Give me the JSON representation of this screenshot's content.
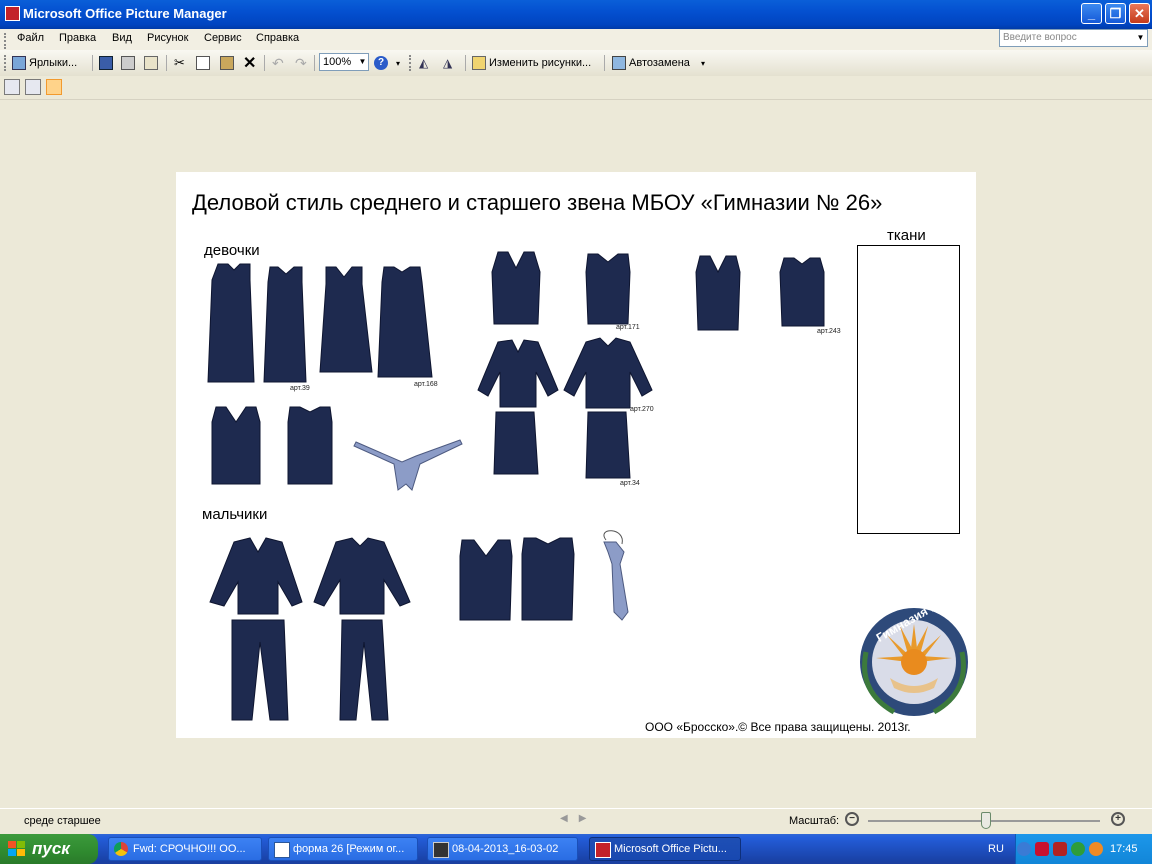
{
  "window": {
    "title": "Microsoft Office Picture Manager",
    "min_symbol": "_",
    "max_symbol": "❐",
    "close_symbol": "✕"
  },
  "menu": {
    "items": [
      "Файл",
      "Правка",
      "Вид",
      "Рисунок",
      "Сервис",
      "Справка"
    ],
    "help_placeholder": "Введите вопрос"
  },
  "toolbar": {
    "shortcuts_label": "Ярлыки...",
    "zoom_value": "100%",
    "edit_label": "Изменить рисунки...",
    "autocorrect_label": "Автозамена"
  },
  "document": {
    "title": "Деловой стиль среднего и старшего звена МБОУ «Гимназии № 26»",
    "girls_label": "девочки",
    "boys_label": "мальчики",
    "fabrics_label": "ткани",
    "articles": [
      "арт.39",
      "арт.168",
      "арт.171",
      "арт.243",
      "арт.270",
      "арт.34"
    ],
    "emblem_text": "Гимназия №26",
    "copyright": "ООО «Бросско».© Все права защищены. 2013г."
  },
  "status": {
    "text": "среде старшее",
    "zoom_label": "Масштаб:",
    "zoom_fraction": 0.5
  },
  "taskbar": {
    "start_label": "пуск",
    "tasks": [
      "Fwd: СРОЧНО!!! ОО...",
      "форма 26 [Режим ог...",
      "08-04-2013_16-03-02",
      "Microsoft Office Pictu..."
    ],
    "language": "RU",
    "clock": "17:45"
  },
  "colors": {
    "garment": "#1e2a4f",
    "tie": "#8c9cc7",
    "titlebar": "#0450d0",
    "taskbar": "#245edb",
    "start": "#2f8a2f"
  }
}
